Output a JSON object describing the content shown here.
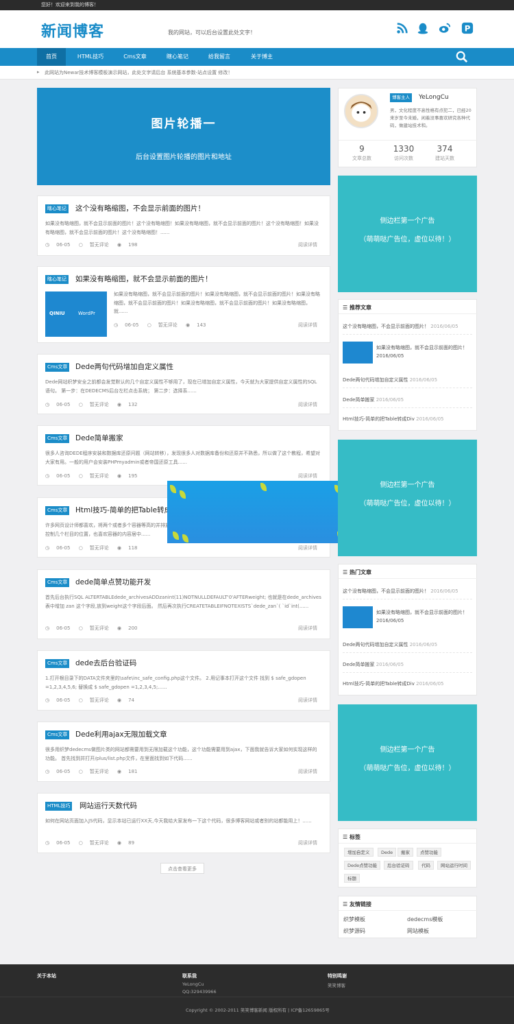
{
  "topbar": {
    "greeting": "您好！欢迎来到我的博客！"
  },
  "header": {
    "logo": "新闻博客",
    "tagline": "我的网站，可以后台设置此处文字！"
  },
  "nav": {
    "items": [
      "首页",
      "HTML技巧",
      "Cms文章",
      "瞎心笔记",
      "给我留言",
      "关于博主"
    ]
  },
  "notice": {
    "text": "此网站为Newar技术博客模板演示网站，此处文字请后台 系统基本参数-站点设置 修改！"
  },
  "banner": {
    "title": "图片轮播一",
    "subtitle": "后台设置图片轮播的图片和地址"
  },
  "posts": [
    {
      "category": "瞎心笔记",
      "title": "这个没有略缩图，不会显示前面的图片！",
      "excerpt": "如果没有略缩图，就不会显示前面的图片！这个没有略缩图！如果没有略缩图，就不会显示前面的图片！这个没有略缩图！如果没有略缩图，就不会显示前面的图片！这个没有略缩图！......",
      "date": "06-05",
      "comments": "暂无评论",
      "views": "198",
      "more": "阅读详情"
    },
    {
      "category": "瞎心笔记",
      "title": "如果没有略缩图，就不会显示前面的图片！",
      "excerpt": "如果没有略缩图，就不会显示前面的图片！如果没有略缩图，就不会显示前面的图片！如果没有略缩图，就不会显示前面的图片！如果没有略缩图，就不会显示前面的图片！如果没有略缩图，就......",
      "date": "06-05",
      "comments": "暂无评论",
      "views": "143",
      "more": "阅读详情",
      "thumb_left": "QINIU",
      "thumb_right": "WordPr"
    },
    {
      "category": "Cms文章",
      "title": "Dede两句代码增加自定义属性",
      "excerpt": "Dede网站织梦安全之前都会发觉默认的几个自定义属性不够用了，现在已增加自定义属性，今天就为大家提供自定义属性的SQL语句。 第一步：在DEDECMS后台左栏点击系统； 第二步：选择系......",
      "date": "06-05",
      "comments": "暂无评论",
      "views": "132",
      "more": "阅读详情"
    },
    {
      "category": "Cms文章",
      "title": "Dede简单搬家",
      "excerpt": "很多人咨询DEDE程序安装和数据库还原问题（网站转移），发现很多人对数据库备份和还原并不熟悉，所以做了这个教程，希望对大家有用。一般的用户会安装PHPmyadmin或者帝国还原工具......",
      "date": "06-05",
      "comments": "暂无评论",
      "views": "195",
      "more": "阅读详情"
    },
    {
      "category": "Cms文章",
      "title": "Html技巧-简单的把Table转成Div",
      "excerpt": "许多网页设计师都喜欢，将两个或者多个容器等高的并排放置，里面展示每个容器的内部信息，就像经典的Table布局中的单元格控制几个栏目的位置，也喜欢容器的内容居中......",
      "date": "06-05",
      "comments": "暂无评论",
      "views": "118",
      "more": "阅读详情"
    },
    {
      "category": "Cms文章",
      "title": "dede简单点赞功能开发",
      "excerpt": "首先后台执行SQL ALTERTABLEdede_archivesADDzanint(11)NOTNULLDEFAULT'0'AFTERweight; 也就是在dede_archives 表中增加 zan 这个字段,放到weight这个字段后面。 然后再次执行CREATETABLEIFNOTEXISTS`dede_zan`( `id`int(......",
      "date": "06-05",
      "comments": "暂无评论",
      "views": "200",
      "more": "阅读详情"
    },
    {
      "category": "Cms文章",
      "title": "dede去后台验证码",
      "excerpt": "1.打开根目录下的DATA文件夹里的\\safe\\inc_safe_config.php这个文件。 2.用记事本打开这个文件 找到 $ safe_gdopen =1,2,3,4,5,6; 替换成 $ safe_gdopen =1,2,3,4,5;......",
      "date": "06-05",
      "comments": "暂无评论",
      "views": "74",
      "more": "阅读详情"
    },
    {
      "category": "Cms文章",
      "title": "Dede利用ajax无限加载文章",
      "excerpt": "很多用织梦dedecms做图片类的网站都需要用到无限加载这个功能，这个功能需要用到ajax，下面我就告诉大家如何实现这样的功能。 首先找到并打开/plus/list.php文件，在里面找到如下代码......",
      "date": "06-05",
      "comments": "暂无评论",
      "views": "181",
      "more": "阅读详情"
    },
    {
      "category": "HTML技巧",
      "title": "网站运行天数代码",
      "excerpt": "如何在网站页面加入JS代码，显示本站已运行XX天,今天我给大家发布一下这个代码，很多博客网站或者别的站都能用上！......",
      "date": "06-05",
      "comments": "暂无评论",
      "views": "89",
      "more": "阅读详情"
    }
  ],
  "load_more": "点击查看更多",
  "profile": {
    "badge": "博客主人",
    "name": "YeLongCu",
    "desc": "男，文化程度不高性格有点犯二，已经20来岁至今未婚，闲着没事喜欢研究各种代码，做建站技术和。",
    "stats": [
      {
        "n": "9",
        "l": "文章总数"
      },
      {
        "n": "1330",
        "l": "访问次数"
      },
      {
        "n": "374",
        "l": "建站天数"
      }
    ]
  },
  "ads": {
    "line1": "侧边栏第一个广告",
    "line2": "（萌萌哒广告位，虚位以待！）"
  },
  "recommend": {
    "title": "推荐文章",
    "items": [
      {
        "t": "这个没有略缩图，不会显示前面的图片！",
        "d": "2016/06/05"
      },
      {
        "t": "如果没有略缩图，就不会显示前面的图片！",
        "d": "2016/06/05"
      },
      {
        "t": "Dede两句代码增加自定义属性",
        "d": "2016/06/05"
      },
      {
        "t": "Dede简单搬家",
        "d": "2016/06/05"
      },
      {
        "t": "Html技巧-简单的把Table转成Div",
        "d": "2016/06/05"
      }
    ]
  },
  "hot": {
    "title": "热门文章",
    "items": [
      {
        "t": "这个没有略缩图，不会显示前面的图片！",
        "d": "2016/06/05"
      },
      {
        "t": "如果没有略缩图，就不会显示前面的图片！",
        "d": "2016/06/05"
      },
      {
        "t": "Dede两句代码增加自定义属性",
        "d": "2016/06/05"
      },
      {
        "t": "Dede简单搬家",
        "d": "2016/06/05"
      },
      {
        "t": "Html技巧-简单的把Table转成Div",
        "d": "2016/06/05"
      }
    ]
  },
  "tags": {
    "title": "标签",
    "items": [
      "增加自定义",
      "Dede",
      "搬家",
      "点赞功能",
      "Dede点赞功能",
      "后台验证码",
      "代码",
      "网站运行时间",
      "标题"
    ]
  },
  "links": {
    "title": "友情链接",
    "items": [
      "织梦模板",
      "dedecms模板",
      "织梦源码",
      "网站模板"
    ]
  },
  "footer": {
    "col1_title": "关于本站",
    "col2_title": "联系我",
    "col2_name": "YeLongCu",
    "col2_qq": "QQ:329439966",
    "col3_title": "特别鸣谢",
    "col3_text": "笑笑博客",
    "copyright": "Copyright © 2002-2011 笑笑博客新闻 版权所有 | ICP备12659865号"
  }
}
